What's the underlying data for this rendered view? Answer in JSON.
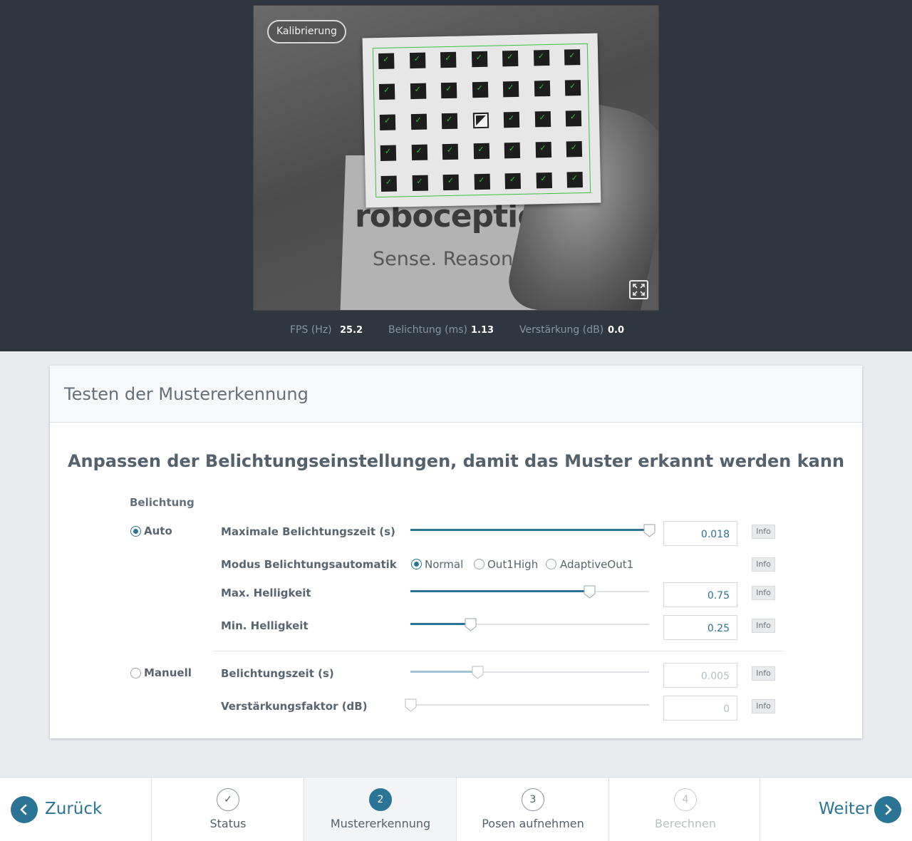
{
  "camera": {
    "badge_label": "Kalibrierung",
    "scene_logo": "roboceptior",
    "scene_tagline": "Sense. Reason. A"
  },
  "stats": {
    "fps_label": "FPS (Hz)",
    "fps_value": "25.2",
    "exposure_label": "Belichtung (ms)",
    "exposure_value": "1.13",
    "gain_label": "Verstärkung (dB)",
    "gain_value": "0.0"
  },
  "card": {
    "title": "Testen der Mustererkennung",
    "heading": "Anpassen der Belichtungseinstellungen, damit das Muster erkannt werden kann",
    "section_label": "Belichtung",
    "mode_auto_label": "Auto",
    "mode_manual_label": "Manuell",
    "selected_mode": "Auto",
    "info_label": "Info",
    "auto_rows": {
      "max_exposure": {
        "label": "Maximale Belichtungszeit (s)",
        "value": "0.018",
        "level": 1.0
      },
      "auto_mode": {
        "label": "Modus Belichtungsautomatik",
        "options": [
          "Normal",
          "Out1High",
          "AdaptiveOut1"
        ],
        "selected": "Normal"
      },
      "max_brightness": {
        "label": "Max. Helligkeit",
        "value": "0.75",
        "level": 0.75
      },
      "min_brightness": {
        "label": "Min. Helligkeit",
        "value": "0.25",
        "level": 0.25
      }
    },
    "manual_rows": {
      "exposure": {
        "label": "Belichtungszeit (s)",
        "value": "0.005",
        "level": 0.28
      },
      "gain": {
        "label": "Verstärkungsfaktor (dB)",
        "value": "0",
        "level": 0.0
      }
    }
  },
  "footer": {
    "back_label": "Zurück",
    "next_label": "Weiter",
    "steps": [
      {
        "number": "✓",
        "label": "Status"
      },
      {
        "number": "2",
        "label": "Mustererkennung"
      },
      {
        "number": "3",
        "label": "Posen aufnehmen"
      },
      {
        "number": "4",
        "label": "Berechnen"
      }
    ]
  },
  "colors": {
    "accent": "#2a7495",
    "dark_bg": "#2e3640",
    "page_bg": "#e9ecef"
  }
}
